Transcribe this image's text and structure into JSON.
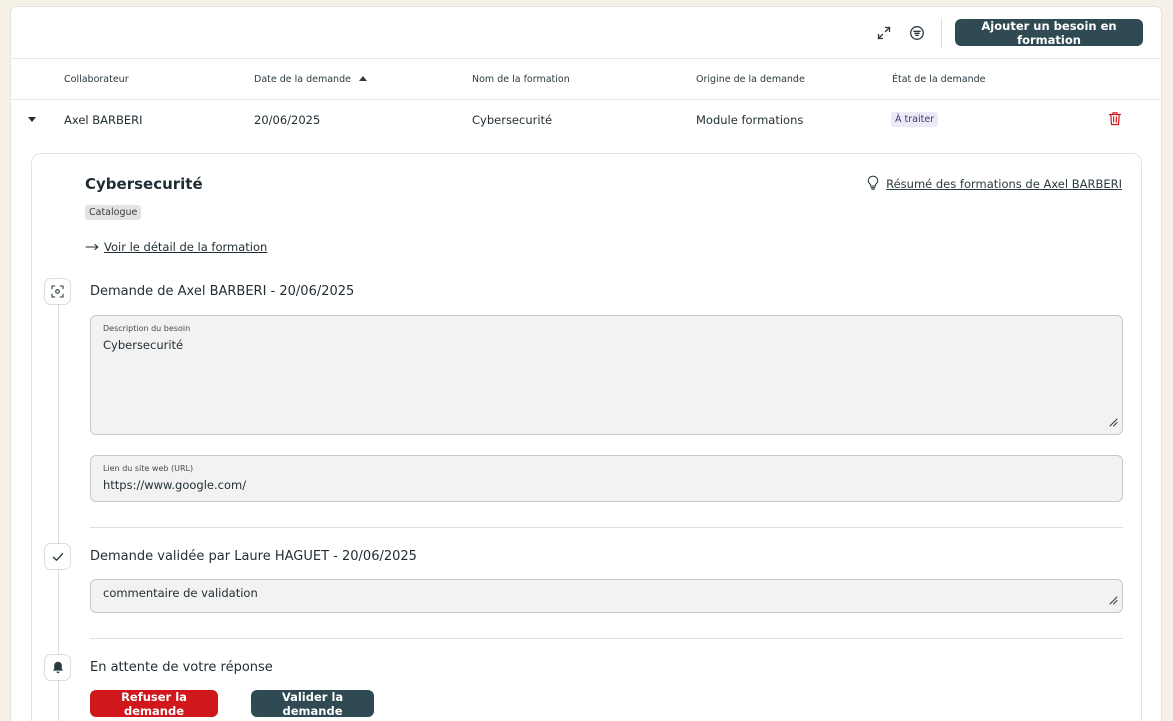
{
  "toolbar": {
    "expand_icon": "expand-icon",
    "filter_icon": "filter-icon",
    "add_button_label": "Ajouter un besoin en formation"
  },
  "table": {
    "columns": [
      "Collaborateur",
      "Date de la demande",
      "Nom de la formation",
      "Origine de la demande",
      "État de la demande"
    ],
    "sort_column": "Date de la demande",
    "sort_direction": "ascending",
    "row": {
      "collaborateur": "Axel BARBERI",
      "date": "20/06/2025",
      "formation": "Cybersecurité",
      "origine": "Module formations",
      "etat": "À traiter"
    }
  },
  "detail": {
    "title": "Cybersecurité",
    "tag": "Catalogue",
    "detail_link": "Voir le détail de la formation",
    "summary_link": "Résumé des formations de Axel BARBERI",
    "steps": [
      {
        "icon": "focus-icon",
        "title": "Demande de Axel BARBERI - 20/06/2025",
        "fields": [
          {
            "label": "Description du besoin",
            "value": "Cybersecurité"
          },
          {
            "label": "Lien du site web (URL)",
            "value": "https://www.google.com/"
          }
        ]
      },
      {
        "icon": "check-icon",
        "title": "Demande validée par Laure HAGUET - 20/06/2025",
        "comment": "commentaire de validation"
      },
      {
        "icon": "bell-icon",
        "title": "En attente de votre réponse"
      }
    ],
    "refuse_label": "Refuser la demande",
    "validate_label": "Valider la demande"
  },
  "colors": {
    "background": "#f6f1e6",
    "primary": "#2f4a52",
    "danger": "#d0171b",
    "status_badge_bg": "#ede9f7"
  }
}
